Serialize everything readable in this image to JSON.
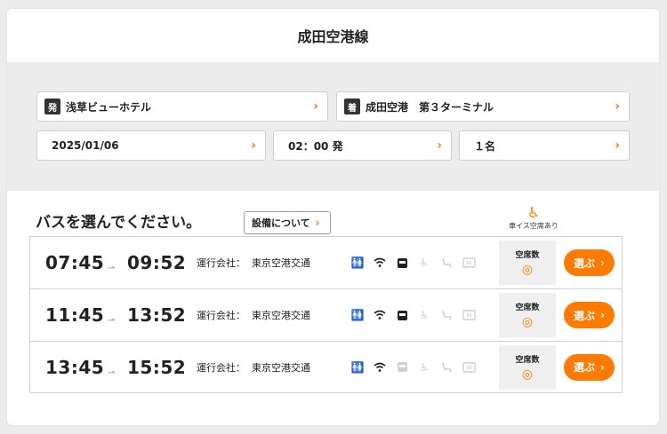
{
  "page": {
    "title": "成田空港線"
  },
  "search": {
    "from_tag": "発",
    "from": "浅草ビューホテル",
    "to_tag": "着",
    "to": "成田空港　第３ターミナル",
    "date": "2025/01/06",
    "time": "02：00 発",
    "passengers": "１名",
    "chevron": "›"
  },
  "list": {
    "heading": "バスを選んでください。",
    "equip_button": "設備について",
    "wheelchair_legend": "車イス空席あり",
    "operator_label": "運行会社：",
    "seat_label": "空席数",
    "select_label": "選ぶ",
    "buses": [
      {
        "dep": "07:45",
        "arr": "09:52",
        "operator": "東京空港交通",
        "seat": "◎"
      },
      {
        "dep": "11:45",
        "arr": "13:52",
        "operator": "東京空港交通",
        "seat": "◎"
      },
      {
        "dep": "13:45",
        "arr": "15:52",
        "operator": "東京空港交通",
        "seat": "◎"
      }
    ]
  },
  "icons": [
    "toilet-icon",
    "wifi-icon",
    "ic-card-icon",
    "wheelchair-icon",
    "reclining-seat-icon",
    "power-outlet-icon"
  ],
  "colors": {
    "accent": "#ff7a00",
    "panel": "#ececec",
    "text": "#222222"
  }
}
